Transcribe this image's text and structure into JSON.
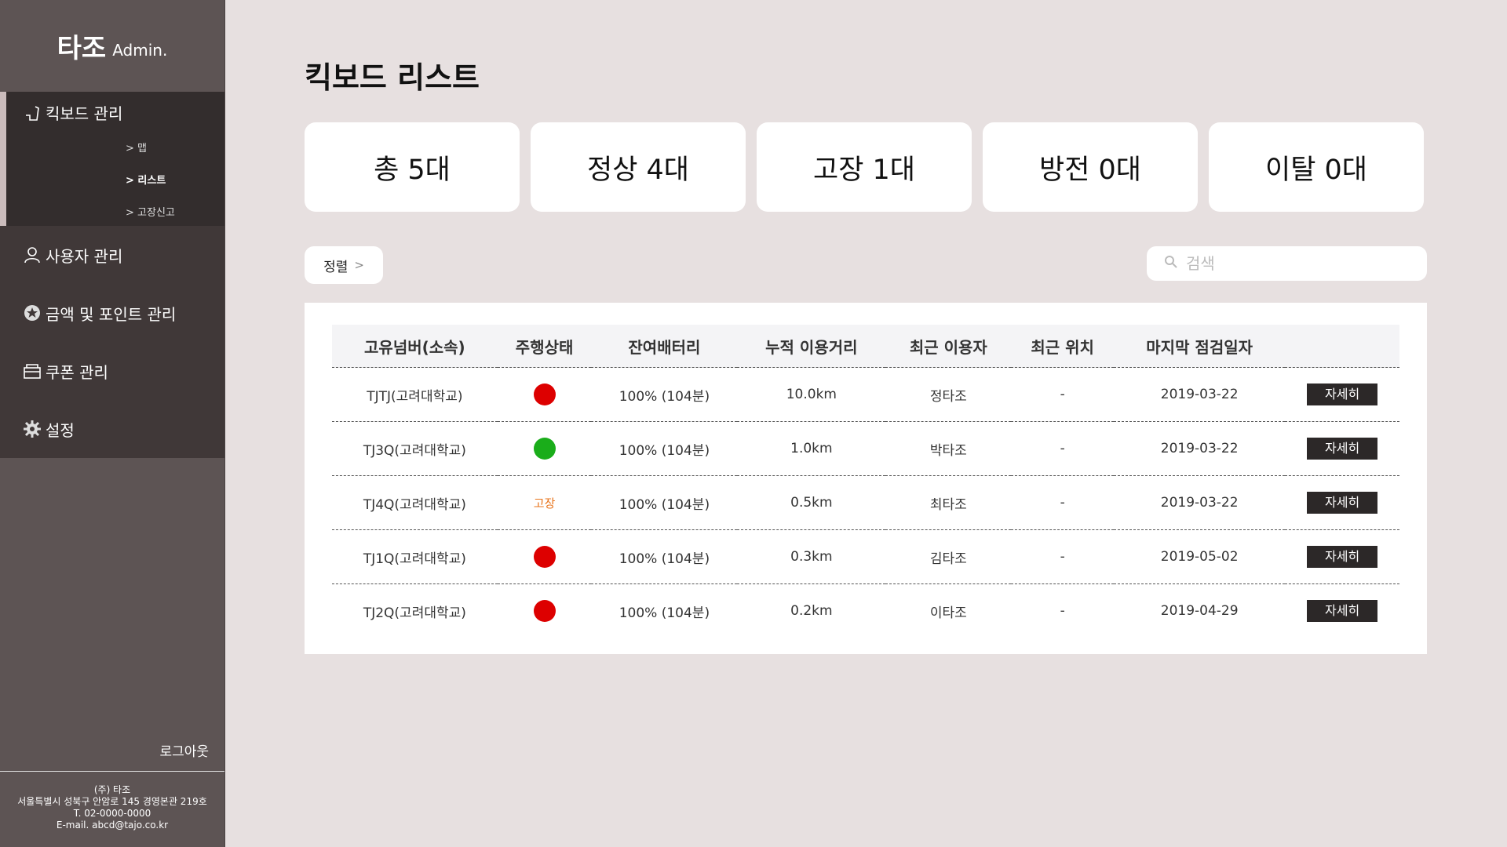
{
  "brand": {
    "name": "타조",
    "suffix": "Admin."
  },
  "sidebar": {
    "menu": [
      {
        "label": "킥보드 관리",
        "icon": "kickboard-icon"
      },
      {
        "label": "사용자 관리",
        "icon": "user-icon"
      },
      {
        "label": "금액 및 포인트 관리",
        "icon": "star-icon"
      },
      {
        "label": "쿠폰 관리",
        "icon": "coupon-icon"
      },
      {
        "label": "설정",
        "icon": "gear-icon"
      }
    ],
    "submenu": [
      "맵",
      "리스트",
      "고장신고"
    ],
    "logout": "로그아웃",
    "footer": {
      "company": "(주) 타조",
      "address": "서울특별시 성북구 안암로 145 경영본관 219호",
      "phone": "T. 02-0000-0000",
      "email": "E-mail. abcd@tajo.co.kr"
    }
  },
  "page": {
    "title": "킥보드 리스트"
  },
  "summary": [
    "총 5대",
    "정상 4대",
    "고장 1대",
    "방전 0대",
    "이탈 0대"
  ],
  "toolbar": {
    "sort_label": "정렬",
    "search_placeholder": "검색"
  },
  "table": {
    "headers": [
      "고유넘버(소속)",
      "주행상태",
      "잔여배터리",
      "누적 이용거리",
      "최근 이용자",
      "최근 위치",
      "마지막 점검일자",
      ""
    ],
    "detail_label": "자세히",
    "rows": [
      {
        "id": "TJTJ(고려대학교)",
        "status": "red",
        "battery": "100% (104분)",
        "distance": "10.0km",
        "user": "정타조",
        "location": "-",
        "date": "2019-03-22"
      },
      {
        "id": "TJ3Q(고려대학교)",
        "status": "green",
        "battery": "100% (104분)",
        "distance": "1.0km",
        "user": "박타조",
        "location": "-",
        "date": "2019-03-22"
      },
      {
        "id": "TJ4Q(고려대학교)",
        "status": "broken",
        "status_text": "고장",
        "battery": "100% (104분)",
        "distance": "0.5km",
        "user": "최타조",
        "location": "-",
        "date": "2019-03-22"
      },
      {
        "id": "TJ1Q(고려대학교)",
        "status": "red",
        "battery": "100% (104분)",
        "distance": "0.3km",
        "user": "김타조",
        "location": "-",
        "date": "2019-05-02"
      },
      {
        "id": "TJ2Q(고려대학교)",
        "status": "red",
        "battery": "100% (104분)",
        "distance": "0.2km",
        "user": "이타조",
        "location": "-",
        "date": "2019-04-29"
      }
    ]
  },
  "colors": {
    "red": "#dd0000",
    "green": "#1aad1a",
    "broken": "#e8741c"
  }
}
